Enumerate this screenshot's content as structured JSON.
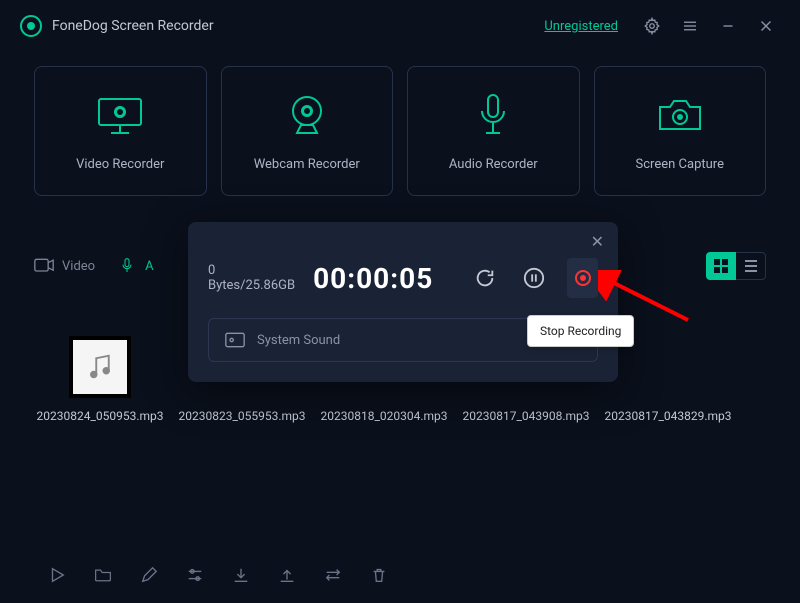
{
  "titlebar": {
    "app_name": "FoneDog Screen Recorder",
    "register_link": "Unregistered"
  },
  "modes": [
    {
      "id": "video-recorder",
      "label": "Video Recorder",
      "icon": "monitor-record-icon"
    },
    {
      "id": "webcam-recorder",
      "label": "Webcam Recorder",
      "icon": "webcam-icon"
    },
    {
      "id": "audio-recorder",
      "label": "Audio Recorder",
      "icon": "microphone-icon"
    },
    {
      "id": "screen-capture",
      "label": "Screen Capture",
      "icon": "camera-icon"
    }
  ],
  "history": {
    "tabs": {
      "video": "Video",
      "audio_partial": "A"
    },
    "files": [
      {
        "name": "20230824_050953.mp3"
      },
      {
        "name": "20230823_055953.mp3"
      },
      {
        "name": "20230818_020304.mp3"
      },
      {
        "name": "20230817_043908.mp3"
      },
      {
        "name": "20230817_043829.mp3"
      }
    ]
  },
  "recording_panel": {
    "bytes_used": "0 Bytes",
    "bytes_sep": "/",
    "bytes_total": "25.86GB",
    "timer": "00:00:05",
    "source_label": "System Sound",
    "tooltip": "Stop Recording",
    "colors": {
      "accent": "#00c896",
      "stop": "#ff3333",
      "panel_bg": "#1a2235"
    }
  }
}
